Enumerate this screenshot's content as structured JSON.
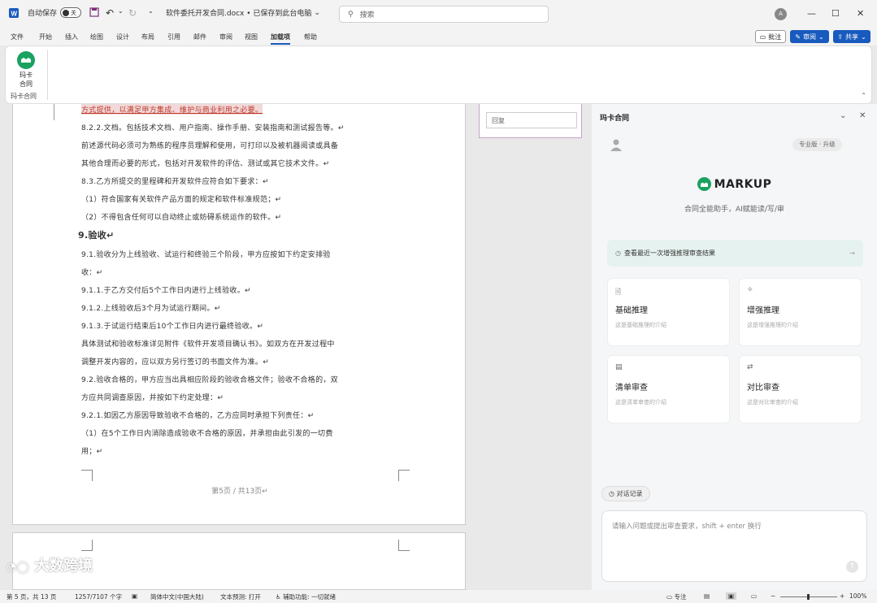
{
  "titlebar": {
    "autosave_label": "自动保存",
    "autosave_state": "关",
    "filename": "软件委托开发合同.docx • 已保存到此台电脑",
    "search_placeholder": "搜索"
  },
  "menu": {
    "items": [
      "文件",
      "开始",
      "插入",
      "绘图",
      "设计",
      "布局",
      "引用",
      "邮件",
      "审阅",
      "视图",
      "加载项",
      "帮助"
    ],
    "comment_btn": "批注",
    "review_btn": "审阅",
    "share_btn": "共享"
  },
  "ribbon": {
    "addin_label_1": "玛卡",
    "addin_label_2": "合同",
    "group_label": "玛卡合同"
  },
  "document": {
    "lines": [
      "方式提供，以满足甲方集成、维护与商业利用之必要。",
      "8.2.2.文档。包括技术文档、用户指南、操作手册、安装指南和测试报告等。↵",
      "前述源代码必须可为熟练的程序员理解和使用，可打印以及被机器阅读或具备",
      "其他合理而必要的形式，包括对开发软件的评估、测试或其它技术文件。↵",
      "8.3.乙方所提交的里程碑和开发软件应符合如下要求：↵",
      "（1）符合国家有关软件产品方面的规定和软件标准规范；↵",
      "（2）不得包含任何可以自动终止或妨碍系统运作的软件。↵",
      "9.验收↵",
      "9.1.验收分为上线验收、试运行和终验三个阶段，甲方应按如下约定安排验",
      "收：↵",
      "9.1.1.于乙方交付后5个工作日内进行上线验收。↵",
      "9.1.2.上线验收后3个月为试运行期间。↵",
      "9.1.3.于试运行结束后10个工作日内进行最终验收。↵",
      "具体测试和验收标准详见附件《软件开发项目确认书》。如双方在开发过程中",
      "调整开发内容的，应以双方另行签订的书面文件为准。↵",
      "9.2.验收合格的，甲方应当出具相应阶段的验收合格文件；验收不合格的，双",
      "方应共同调查原因，并按如下约定处理：↵",
      "9.2.1.如因乙方原因导致验收不合格的，乙方应同时承担下列责任：↵",
      "（1）在5个工作日内消除造成验收不合格的原因，并承担由此引发的一切费",
      "用；↵"
    ],
    "page_footer": "第5页 / 共13页↵",
    "comment_placeholder": "回复"
  },
  "panel": {
    "title": "玛卡合同",
    "version_badge": "专业版 · 升级",
    "brand": "MARKUP",
    "tagline": "合同全能助手，AI赋能读/写/审",
    "notice": "查看最近一次增强推理审查结果",
    "cards": [
      {
        "title": "基础推理",
        "desc": "这是基础推理的介绍"
      },
      {
        "title": "增强推理",
        "desc": "这是增强推理的介绍"
      },
      {
        "title": "清单审查",
        "desc": "这是清单审查的介绍"
      },
      {
        "title": "对比审查",
        "desc": "这是对比审查的介绍"
      }
    ],
    "history_btn": "对话记录",
    "input_placeholder": "请输入问题或提出审查要求，shift + enter 换行"
  },
  "status": {
    "page": "第 5 页，共 13 页",
    "words": "1257/7107 个字",
    "language": "简体中文(中国大陆)",
    "prediction": "文本预测: 打开",
    "accessibility": "辅助功能: 一切就绪",
    "focus": "专注",
    "zoom": "100%"
  },
  "watermark": "大数跨境",
  "colors": {
    "accent": "#185abd",
    "brand_green": "#1aa260"
  }
}
